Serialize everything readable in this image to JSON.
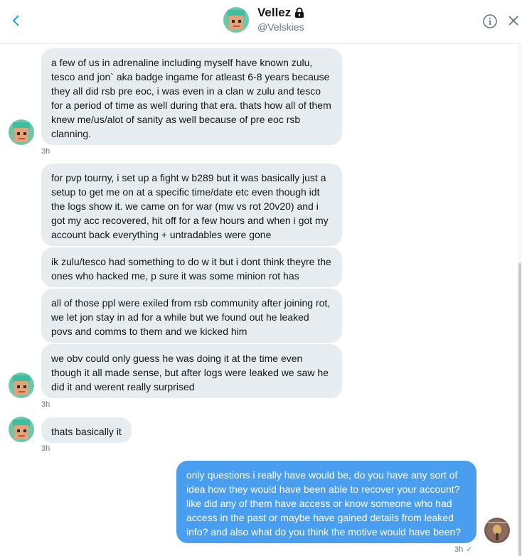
{
  "header": {
    "name": "Vellez",
    "handle": "@Velskies"
  },
  "messages": [
    {
      "text": "a few of us in adrenaline including myself have known zulu, tesco and jon` aka badge ingame for atleast 6-8 years because they all did rsb pre eoc, i was even in a clan w zulu and tesco for a period of time as well during that era. thats how all of them knew me/us/alot of sanity as well because of pre eoc rsb clanning.",
      "time": "3h"
    },
    {
      "text": "for pvp tourny, i set up a fight w b289 but it was basically just a setup to get me on at a specific time/date etc even though idt the logs show it. we came on for war (mw vs rot 20v20) and i got my acc recovered, hit off for a few hours and when i got my account back everything + untradables were gone"
    },
    {
      "text": "ik zulu/tesco had something to do w it but i dont think theyre the ones who hacked me, p sure it was some minion rot has"
    },
    {
      "text": "all of those ppl were exiled from rsb community after joining rot, we let jon stay in ad for a while but we found out he leaked povs and comms to them and we kicked him"
    },
    {
      "text": "we obv could only guess he was doing it at the time even though it all made sense, but after logs were leaked we saw he did it and werent really surprised",
      "time": "3h"
    },
    {
      "text": "thats basically it",
      "time": "3h"
    },
    {
      "text": "only questions i really have would be, do you have any sort of idea how they would have been able to recover your account? like did any of them have access or know someone who had access in the past or maybe have gained details from leaked info? and also what do you think the motive would have been?",
      "time": "3h",
      "status": "✓"
    }
  ],
  "colors": {
    "received_bubble": "#e6ecf0",
    "sent_bubble": "#4a9ef0",
    "accent": "#1da1f2"
  }
}
